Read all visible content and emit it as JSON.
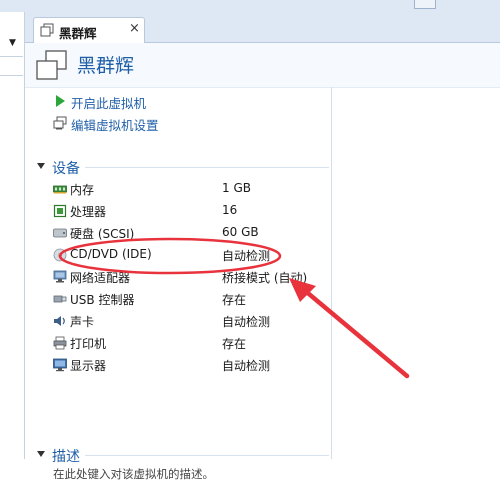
{
  "tab": {
    "title": "黑群辉",
    "close": "×"
  },
  "vm": {
    "title": "黑群辉"
  },
  "actions": [
    {
      "id": "power-on",
      "label": "开启此虚拟机",
      "icon": "play-icon"
    },
    {
      "id": "edit-settings",
      "label": "编辑虚拟机设置",
      "icon": "settings-icon"
    }
  ],
  "devices_section": {
    "title": "设备"
  },
  "devices": [
    {
      "name": "内存",
      "value": "1 GB",
      "icon": "memory-icon"
    },
    {
      "name": "处理器",
      "value": "16",
      "icon": "cpu-icon"
    },
    {
      "name": "硬盘 (SCSI)",
      "value": "60 GB",
      "icon": "harddisk-icon"
    },
    {
      "name": "CD/DVD (IDE)",
      "value": "自动检测",
      "icon": "cdrom-icon"
    },
    {
      "name": "网络适配器",
      "value": "桥接模式 (自动)",
      "icon": "network-icon"
    },
    {
      "name": "USB 控制器",
      "value": "存在",
      "icon": "usb-icon"
    },
    {
      "name": "声卡",
      "value": "自动检测",
      "icon": "sound-icon"
    },
    {
      "name": "打印机",
      "value": "存在",
      "icon": "printer-icon"
    },
    {
      "name": "显示器",
      "value": "自动检测",
      "icon": "display-icon"
    }
  ],
  "description_section": {
    "title": "描述",
    "placeholder": "在此处键入对该虚拟机的描述。"
  },
  "annotation_color": "#e8323c"
}
